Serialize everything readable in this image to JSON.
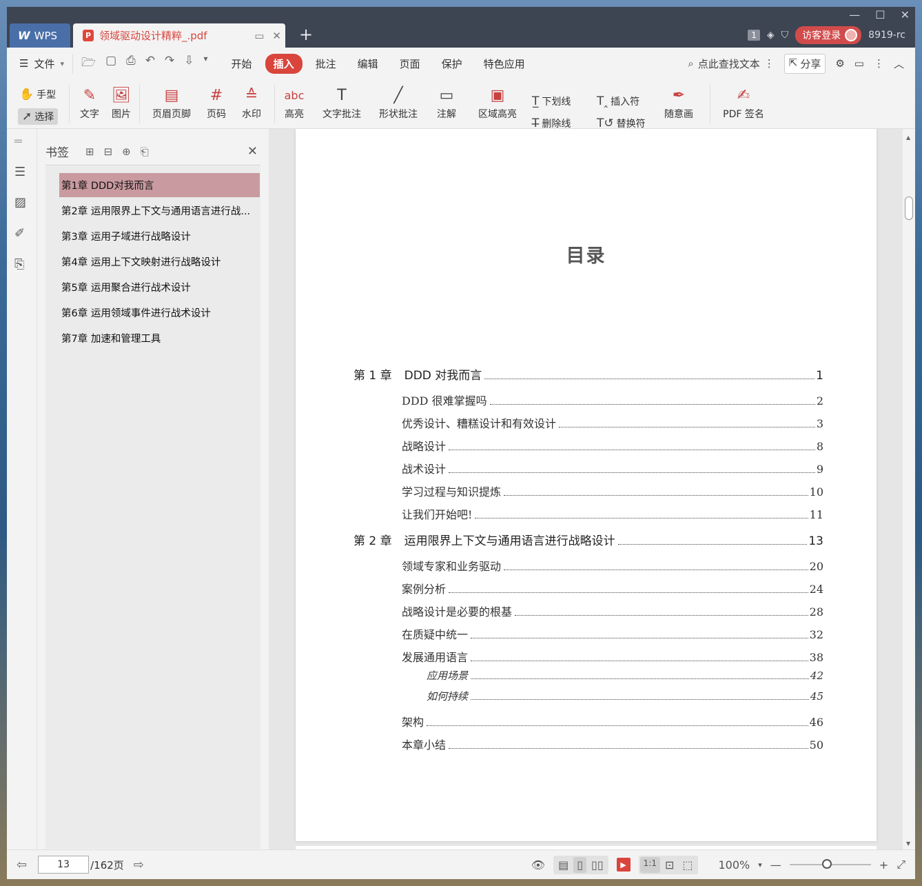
{
  "titlebar": {
    "app_tab": "WPS",
    "doc_tab": "领域驱动设计精粹_.pdf",
    "pdf_badge": "P",
    "add_tab": "+",
    "page_counter": "1",
    "login_label": "访客登录",
    "user_id": "8919-rc"
  },
  "menubar": {
    "file_label": "文件",
    "tabs": [
      "开始",
      "插入",
      "批注",
      "编辑",
      "页面",
      "保护",
      "特色应用"
    ],
    "active_tab": "插入",
    "search_label": "点此查找文本",
    "share_label": "分享"
  },
  "ribbon": {
    "hand": "手型",
    "select": "选择",
    "text": "文字",
    "image": "图片",
    "header_footer": "页眉页脚",
    "page_number": "页码",
    "watermark": "水印",
    "highlight": "高亮",
    "text_comment": "文字批注",
    "shape_comment": "形状批注",
    "annotation": "注解",
    "area_highlight": "区域高亮",
    "underline": "下划线",
    "strikethrough": "删除线",
    "insert_mark": "插入符",
    "replace_mark": "替换符",
    "freehand": "随意画",
    "pdf_sign": "PDF 签名"
  },
  "bookmarks": {
    "title": "书签",
    "items": [
      "第1章 DDD对我而言",
      "第2章 运用限界上下文与通用语言进行战...",
      "第3章 运用子域进行战略设计",
      "第4章 运用上下文映射进行战略设计",
      "第5章 运用聚合进行战术设计",
      "第6章 运用领域事件进行战术设计",
      "第7章 加速和管理工具"
    ]
  },
  "document": {
    "page_title": "目录",
    "toc": [
      {
        "level": "chapter",
        "num": "第 1 章",
        "title": "DDD 对我而言",
        "page": "1"
      },
      {
        "level": "section",
        "title": "DDD 很难掌握吗",
        "page": "2"
      },
      {
        "level": "section",
        "title": "优秀设计、糟糕设计和有效设计",
        "page": "3"
      },
      {
        "level": "section",
        "title": "战略设计",
        "page": "8"
      },
      {
        "level": "section",
        "title": "战术设计",
        "page": "9"
      },
      {
        "level": "section",
        "title": "学习过程与知识提炼",
        "page": "10"
      },
      {
        "level": "section",
        "title": "让我们开始吧!",
        "page": "11"
      },
      {
        "level": "chapter",
        "num": "第 2 章",
        "title": "运用限界上下文与通用语言进行战略设计",
        "page": "13"
      },
      {
        "level": "section",
        "title": "领域专家和业务驱动",
        "page": "20"
      },
      {
        "level": "section",
        "title": "案例分析",
        "page": "24"
      },
      {
        "level": "section",
        "title": "战略设计是必要的根基",
        "page": "28"
      },
      {
        "level": "section",
        "title": "在质疑中统一",
        "page": "32"
      },
      {
        "level": "section",
        "title": "发展通用语言",
        "page": "38"
      },
      {
        "level": "sub",
        "title": "应用场景",
        "page": "42"
      },
      {
        "level": "sub",
        "title": "如何持续",
        "page": "45"
      },
      {
        "level": "section",
        "title": "架构",
        "page": "46"
      },
      {
        "level": "section",
        "title": "本章小结",
        "page": "50"
      }
    ]
  },
  "statusbar": {
    "current_page": "13",
    "total_pages": "/162页",
    "zoom": "100%",
    "zoom_level_fraction": 0.45
  }
}
